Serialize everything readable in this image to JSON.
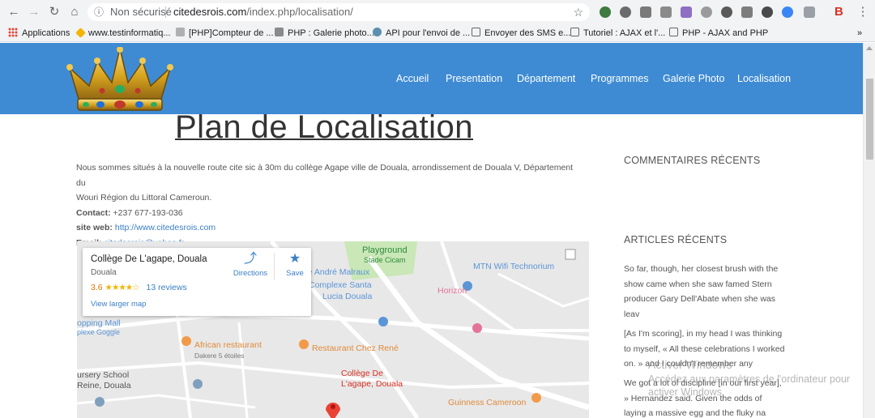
{
  "browser": {
    "security_label": "Non sécurisé",
    "url_domain": "citedesrois.com",
    "url_path": "/index.php/localisation/",
    "bookmarks": [
      "Applications",
      "www.testinformatiq...",
      "[PHP]Compteur de ...",
      "PHP : Galerie photo...",
      "API pour l'envoi de ...",
      "Envoyer des SMS e...",
      "Tutoriel : AJAX et l'...",
      "PHP - AJAX and PHP"
    ],
    "more": "»"
  },
  "header": {
    "nav": [
      "Accueil",
      "Presentation",
      "Département",
      "Programmes",
      "Galerie Photo",
      "Localisation"
    ]
  },
  "main": {
    "title": "Plan de Localisation",
    "line1": "Nous sommes situés à la nouvelle route cite sic à 30m du collège Agape ville de Douala, arrondissement de Douala V, Département du",
    "line2": "Wouri Région du Littoral Cameroun.",
    "contact_label": "Contact:",
    "contact_value": "+237 677-193-036",
    "web_label": "site web:",
    "web_value": "http://www.citedesrois.com",
    "email_label": "Email:",
    "email_value": "citedesrois@yahoo.fr"
  },
  "map": {
    "place_name": "Collège De L'agape, Douala",
    "place_city": "Douala",
    "rating": "3.6",
    "stars": "★★★★☆",
    "reviews": "13 reviews",
    "larger": "View larger map",
    "directions": "Directions",
    "save": "Save",
    "labels": {
      "playground": "Playground",
      "stade": "Stade Cicam",
      "malraux": "ège André Malraux",
      "complexe1": "Complexe Santa",
      "complexe2": "Lucia Douala",
      "mtn": "MTN Wifi Technorium",
      "horizon": "Horizon",
      "opping1": "opping Mall",
      "opping2": "plexe Goggle",
      "african": "African restaurant",
      "dakere": "Dakere 5 étoiles",
      "chezrene": "Restaurant Chez René",
      "college1": "Collège De",
      "college2": "L'agape, Douala",
      "nursery1": "ursery School",
      "nursery2": "Reine, Douala",
      "guinness": "Guinness Cameroon"
    }
  },
  "sidebar": {
    "comments_title": "COMMENTAIRES RÉCENTS",
    "articles_title": "ARTICLES RÉCENTS",
    "article1": "So far, though, her closest brush with the show came when she saw famed Stern producer Gary Dell'Abate when she was leav",
    "article2": "[As I'm scoring], in my head I was thinking to myself, « All these celebrations I worked on. » and I couldn't remember any",
    "article3": "We got a lot of discipline [in our first year], » Hernandez said. Given the odds of laying a massive egg and the fluky na"
  },
  "watermark": {
    "line1": "Activer Windows",
    "line2": "Accédez aux paramètres de l'ordinateur pour",
    "line3": "activer Windows."
  },
  "colors": {
    "header": "#3e8bd3",
    "link": "#3a7fc6",
    "pin": "#ea4335"
  }
}
